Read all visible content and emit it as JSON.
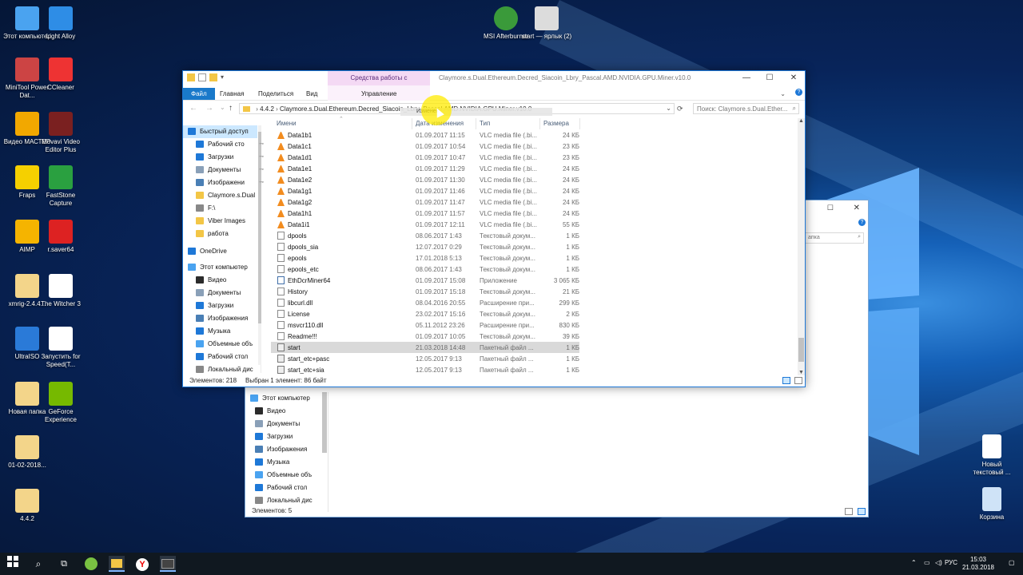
{
  "desktop": {
    "icons_left": [
      {
        "label": "Этот компьютер",
        "color": "#4aa3f0"
      },
      {
        "label": "Light Alloy",
        "color": "#2e8de6"
      },
      {
        "label": "MiniTool Power Dat...",
        "color": "#c44"
      },
      {
        "label": "CCleaner",
        "color": "#e33"
      },
      {
        "label": "Видео МАСТЕР",
        "color": "#f2a800"
      },
      {
        "label": "Movavi Video Editor Plus",
        "color": "#7a2020"
      },
      {
        "label": "Fraps",
        "color": "#f5d000"
      },
      {
        "label": "FastStone Capture",
        "color": "#2aa040"
      },
      {
        "label": "AIMP",
        "color": "#f5b400"
      },
      {
        "label": "r.saver64",
        "color": "#d22"
      },
      {
        "label": "xmrig-2.4.4...",
        "color": "#f3d58a"
      },
      {
        "label": "The Witcher 3",
        "color": "#ffffff"
      },
      {
        "label": "UltraISO",
        "color": "#2a7ad8"
      },
      {
        "label": "Запустить for Speed(T...",
        "color": "#ffffff"
      },
      {
        "label": "Новая папка",
        "color": "#f3d58a"
      },
      {
        "label": "GeForce Experience",
        "color": "#76b900"
      },
      {
        "label": "01-02-2018...",
        "color": "#f3d58a"
      },
      {
        "label": "4.4.2",
        "color": "#f3d58a"
      }
    ],
    "icons_top": [
      {
        "label": "MSI Afterburner",
        "color": "#3a9a3a"
      },
      {
        "label": "start — ярлык (2)",
        "color": "#dcdcdc"
      }
    ],
    "icons_right": [
      {
        "label": "Новый текстовый ...",
        "color": "#ffffff"
      },
      {
        "label": "Корзина",
        "color": "#cfe3f7"
      }
    ]
  },
  "back_window": {
    "search_placeholder": "апка",
    "nav": [
      {
        "label": "Этот компьютер",
        "color": "#4aa3f0"
      },
      {
        "label": "Видео",
        "color": "#2b2b2b"
      },
      {
        "label": "Документы",
        "color": "#8aa0b8"
      },
      {
        "label": "Загрузки",
        "color": "#1e78d7"
      },
      {
        "label": "Изображения",
        "color": "#4a7fb5"
      },
      {
        "label": "Музыка",
        "color": "#1e78d7"
      },
      {
        "label": "Объемные объ",
        "color": "#4aa3f0"
      },
      {
        "label": "Рабочий стол",
        "color": "#1e78d7"
      },
      {
        "label": "Локальный дис",
        "color": "#888888"
      }
    ],
    "status": "Элементов: 5"
  },
  "window": {
    "context_tab": "Средства работы с приложениями",
    "title": "Claymore.s.Dual.Ethereum.Decred_Siacoin_Lbry_Pascal.AMD.NVIDIA.GPU.Miner.v10.0",
    "ribbon_tabs": [
      "Файл",
      "Главная",
      "Поделиться",
      "Вид",
      "Управление"
    ],
    "address": {
      "crumbs": [
        "4.4.2",
        "Claymore.s.Dual.Ethereum.Decred_Siacoin_Lbry_Pascal.AMD.NVIDIA.GPU.Miner.v10.0"
      ],
      "search_placeholder": "Поиск: Claymore.s.Dual.Ether..."
    },
    "tooltip": "Изменен",
    "sidebar": [
      {
        "label": "Быстрый доступ",
        "color": "#1e78d7",
        "indent": 0,
        "pin": false
      },
      {
        "label": "Рабочий сто",
        "color": "#1e78d7",
        "indent": 1,
        "pin": true
      },
      {
        "label": "Загрузки",
        "color": "#1e78d7",
        "indent": 1,
        "pin": true
      },
      {
        "label": "Документы",
        "color": "#8aa0b8",
        "indent": 1,
        "pin": true
      },
      {
        "label": "Изображени",
        "color": "#4a7fb5",
        "indent": 1,
        "pin": true
      },
      {
        "label": "Claymore.s.Dual",
        "color": "#f3c646",
        "indent": 1,
        "pin": false
      },
      {
        "label": "F:\\",
        "color": "#888888",
        "indent": 1,
        "pin": false
      },
      {
        "label": "Viber Images",
        "color": "#f3c646",
        "indent": 1,
        "pin": false
      },
      {
        "label": "работа",
        "color": "#f3c646",
        "indent": 1,
        "pin": false
      },
      {
        "label": "OneDrive",
        "color": "#1e78d7",
        "indent": 0,
        "pin": false
      },
      {
        "label": "Этот компьютер",
        "color": "#4aa3f0",
        "indent": 0,
        "pin": false
      },
      {
        "label": "Видео",
        "color": "#2b2b2b",
        "indent": 1,
        "pin": false
      },
      {
        "label": "Документы",
        "color": "#8aa0b8",
        "indent": 1,
        "pin": false
      },
      {
        "label": "Загрузки",
        "color": "#1e78d7",
        "indent": 1,
        "pin": false
      },
      {
        "label": "Изображения",
        "color": "#4a7fb5",
        "indent": 1,
        "pin": false
      },
      {
        "label": "Музыка",
        "color": "#1e78d7",
        "indent": 1,
        "pin": false
      },
      {
        "label": "Объемные объ",
        "color": "#4aa3f0",
        "indent": 1,
        "pin": false
      },
      {
        "label": "Рабочий стол",
        "color": "#1e78d7",
        "indent": 1,
        "pin": false
      },
      {
        "label": "Локальный дис",
        "color": "#888888",
        "indent": 1,
        "pin": false
      }
    ],
    "columns": [
      "Имени",
      "Дата изменения",
      "Тип",
      "Размера"
    ],
    "files": [
      {
        "name": "Data1b1",
        "date": "01.09.2017 11:15",
        "type": "VLC media file (.bi...",
        "size": "24 КБ",
        "icon": "vlc",
        "selected": false
      },
      {
        "name": "Data1c1",
        "date": "01.09.2017 10:54",
        "type": "VLC media file (.bi...",
        "size": "23 КБ",
        "icon": "vlc",
        "selected": false
      },
      {
        "name": "Data1d1",
        "date": "01.09.2017 10:47",
        "type": "VLC media file (.bi...",
        "size": "23 КБ",
        "icon": "vlc",
        "selected": false
      },
      {
        "name": "Data1e1",
        "date": "01.09.2017 11:29",
        "type": "VLC media file (.bi...",
        "size": "24 КБ",
        "icon": "vlc",
        "selected": false
      },
      {
        "name": "Data1e2",
        "date": "01.09.2017 11:30",
        "type": "VLC media file (.bi...",
        "size": "24 КБ",
        "icon": "vlc",
        "selected": false
      },
      {
        "name": "Data1g1",
        "date": "01.09.2017 11:46",
        "type": "VLC media file (.bi...",
        "size": "24 КБ",
        "icon": "vlc",
        "selected": false
      },
      {
        "name": "Data1g2",
        "date": "01.09.2017 11:47",
        "type": "VLC media file (.bi...",
        "size": "24 КБ",
        "icon": "vlc",
        "selected": false
      },
      {
        "name": "Data1h1",
        "date": "01.09.2017 11:57",
        "type": "VLC media file (.bi...",
        "size": "24 КБ",
        "icon": "vlc",
        "selected": false
      },
      {
        "name": "Data1i1",
        "date": "01.09.2017 12:11",
        "type": "VLC media file (.bi...",
        "size": "55 КБ",
        "icon": "vlc",
        "selected": false
      },
      {
        "name": "dpools",
        "date": "08.06.2017 1:43",
        "type": "Текстовый докум...",
        "size": "1 КБ",
        "icon": "doc",
        "selected": false
      },
      {
        "name": "dpools_sia",
        "date": "12.07.2017 0:29",
        "type": "Текстовый докум...",
        "size": "1 КБ",
        "icon": "doc",
        "selected": false
      },
      {
        "name": "epools",
        "date": "17.01.2018 5:13",
        "type": "Текстовый докум...",
        "size": "1 КБ",
        "icon": "doc",
        "selected": false
      },
      {
        "name": "epools_etc",
        "date": "08.06.2017 1:43",
        "type": "Текстовый докум...",
        "size": "1 КБ",
        "icon": "doc",
        "selected": false
      },
      {
        "name": "EthDcrMiner64",
        "date": "01.09.2017 15:08",
        "type": "Приложение",
        "size": "3 065 КБ",
        "icon": "app",
        "selected": false
      },
      {
        "name": "History",
        "date": "01.09.2017 15:18",
        "type": "Текстовый докум...",
        "size": "21 КБ",
        "icon": "doc",
        "selected": false
      },
      {
        "name": "libcurl.dll",
        "date": "08.04.2016 20:55",
        "type": "Расширение при...",
        "size": "299 КБ",
        "icon": "doc",
        "selected": false
      },
      {
        "name": "License",
        "date": "23.02.2017 15:16",
        "type": "Текстовый докум...",
        "size": "2 КБ",
        "icon": "doc",
        "selected": false
      },
      {
        "name": "msvcr110.dll",
        "date": "05.11.2012 23:26",
        "type": "Расширение при...",
        "size": "830 КБ",
        "icon": "doc",
        "selected": false
      },
      {
        "name": "Readme!!!",
        "date": "01.09.2017 10:05",
        "type": "Текстовый докум...",
        "size": "39 КБ",
        "icon": "doc",
        "selected": false
      },
      {
        "name": "start",
        "date": "21.03.2018 14:48",
        "type": "Пакетный файл ...",
        "size": "1 КБ",
        "icon": "bat",
        "selected": true
      },
      {
        "name": "start_etc+pasc",
        "date": "12.05.2017 9:13",
        "type": "Пакетный файл ...",
        "size": "1 КБ",
        "icon": "bat",
        "selected": false
      },
      {
        "name": "start_etc+sia",
        "date": "12.05.2017 9:13",
        "type": "Пакетный файл ...",
        "size": "1 КБ",
        "icon": "bat",
        "selected": false
      }
    ],
    "status_count": "Элементов: 218",
    "status_selected": "Выбран 1 элемент: 86 байт"
  },
  "taskbar": {
    "lang": "РУС",
    "time": "15:03",
    "date": "21.03.2018"
  }
}
